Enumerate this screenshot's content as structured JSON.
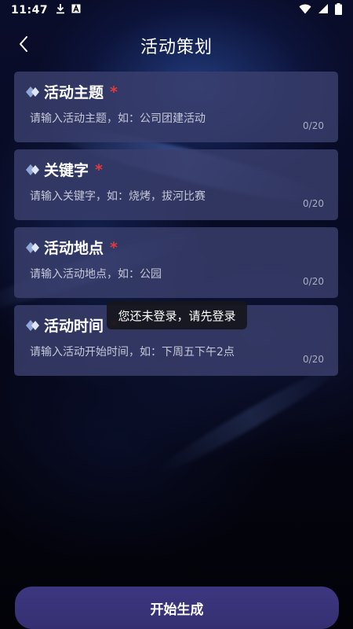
{
  "status_bar": {
    "time": "11:47",
    "icons": [
      "download-icon",
      "app-a-icon",
      "wifi-icon",
      "signal-icon",
      "battery-icon"
    ]
  },
  "header": {
    "title": "活动策划",
    "back_icon": "chevron-left-icon"
  },
  "form": {
    "fields": [
      {
        "label": "活动主题",
        "required_mark": "*",
        "placeholder": "请输入活动主题，如：公司团建活动",
        "counter": "0/20"
      },
      {
        "label": "关键字",
        "required_mark": "*",
        "placeholder": "请输入关键字，如：烧烤，拔河比赛",
        "counter": "0/20"
      },
      {
        "label": "活动地点",
        "required_mark": "*",
        "placeholder": "请输入活动地点，如：公园",
        "counter": "0/20"
      },
      {
        "label": "活动时间",
        "required_mark": "*",
        "placeholder": "请输入活动开始时间，如：下周五下午2点",
        "counter": "0/20"
      }
    ]
  },
  "toast": {
    "message": "您还未登录，请先登录"
  },
  "actions": {
    "generate_label": "开始生成"
  },
  "colors": {
    "card_bg": "#3a406e",
    "required": "#e43b3b",
    "button_bg": "#3d3780",
    "background": "#04040f"
  }
}
